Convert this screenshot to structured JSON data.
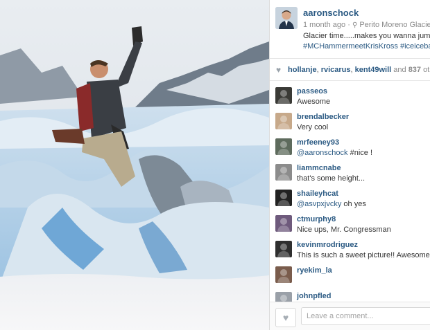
{
  "post": {
    "owner": "aaronschock",
    "time_ago": "1 month ago",
    "location": "Perito Moreno Glacier",
    "caption_line1": "Glacier time.....makes you wanna jump,",
    "caption_line2": "#MCHammermeetKrisKross #iceicebab"
  },
  "likes": {
    "users": [
      "hollanje",
      "rvicarus",
      "kent49will"
    ],
    "and_text": "and",
    "count": "837",
    "suffix": "othe"
  },
  "comments": [
    {
      "user": "passeos",
      "text": "Awesome",
      "avatar_color": "#3a3a36"
    },
    {
      "user": "brendalbecker",
      "text": "Very cool",
      "avatar_color": "#c7a98a"
    },
    {
      "user": "mrfeeney93",
      "mention": "@aaronschock",
      "text": " #nice !",
      "avatar_color": "#5e6b5d"
    },
    {
      "user": "liammcnabe",
      "text": "that's some height...",
      "avatar_color": "#8c8c8c"
    },
    {
      "user": "shaileyhcat",
      "mention": "@asvpxjvcky",
      "text": " oh yes",
      "avatar_color": "#222222"
    },
    {
      "user": "ctmurphy8",
      "text": "Nice ups, Mr. Congressman",
      "avatar_color": "#6e5a7c"
    },
    {
      "user": "kevinmrodriguez",
      "text": "This is such a sweet picture!! Awesome!",
      "avatar_color": "#2f2f2f"
    },
    {
      "user": "ryekim_la",
      "text": "",
      "avatar_color": "#7a5c4c"
    },
    {
      "user": "johnpfled",
      "text": "",
      "avatar_color": "#9aa0a8"
    }
  ],
  "footer": {
    "comment_placeholder": "Leave a comment..."
  }
}
